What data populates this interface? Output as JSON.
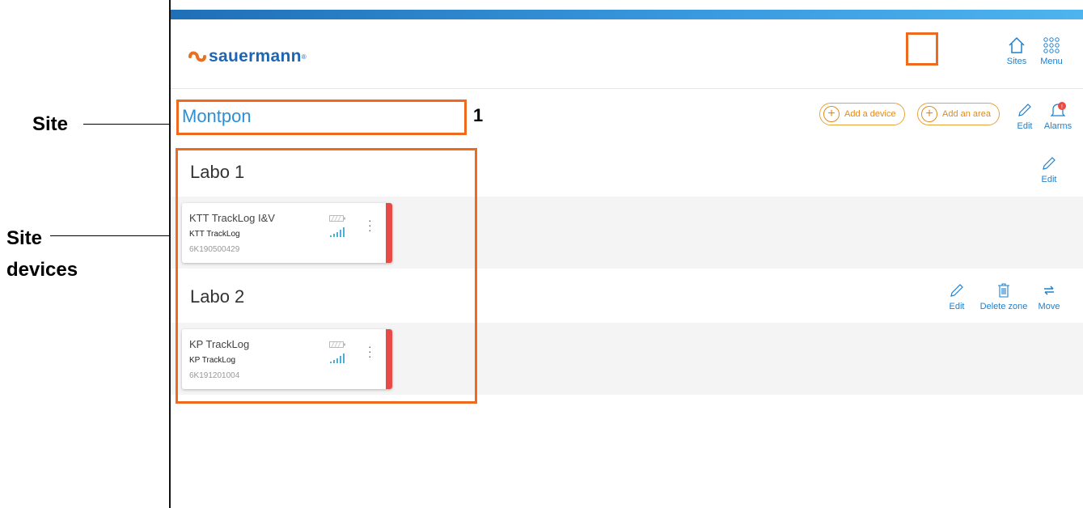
{
  "annotations": {
    "site_label": "Site",
    "site_devices_label_line1": "Site",
    "site_devices_label_line2": "devices",
    "number_1": "1"
  },
  "header": {
    "logo_text": "sauermann",
    "logo_reg": "®",
    "sites_label": "Sites",
    "menu_label": "Menu"
  },
  "site": {
    "name": "Montpon",
    "add_device_label": "Add a device",
    "add_area_label": "Add an area",
    "edit_label": "Edit",
    "alarms_label": "Alarms",
    "alarm_badge": "!"
  },
  "zones": [
    {
      "title": "Labo 1",
      "edit_label": "Edit",
      "devices": [
        {
          "name": "KTT TrackLog I&V",
          "type": "KTT TrackLog",
          "serial": "6K190500429"
        }
      ]
    },
    {
      "title": "Labo 2",
      "edit_label": "Edit",
      "delete_label": "Delete zone",
      "move_label": "Move",
      "devices": [
        {
          "name": "KP TrackLog",
          "type": "KP TrackLog",
          "serial": "6K191201004"
        }
      ]
    }
  ],
  "colors": {
    "accent_blue": "#1e80cc",
    "accent_orange": "#e08a1e",
    "status_red": "#e84b45",
    "annotation_orange": "#ee6a1f"
  }
}
